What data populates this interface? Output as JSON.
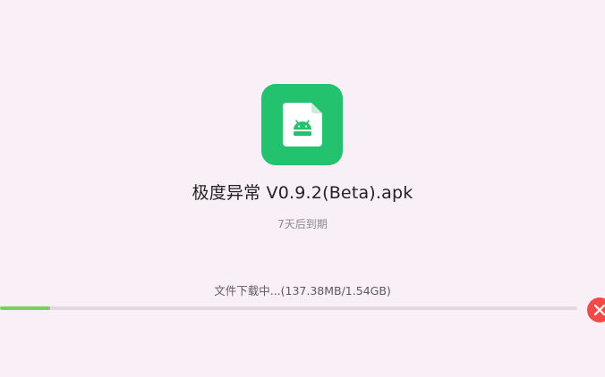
{
  "file": {
    "name": "极度异常 V0.9.2(Beta).apk",
    "expiry": "7天后到期",
    "icon": "android-apk-file-icon"
  },
  "download": {
    "status_text": "文件下载中...(137.38MB/1.54GB)",
    "progress": 0.0871
  },
  "cancel": {
    "icon": "close-icon"
  },
  "colors": {
    "background": "#f9eff7",
    "icon_tile": "#22c26f",
    "progress_fill": "#7cce5a",
    "progress_track": "#e0dade",
    "cancel": "#f44a46"
  }
}
